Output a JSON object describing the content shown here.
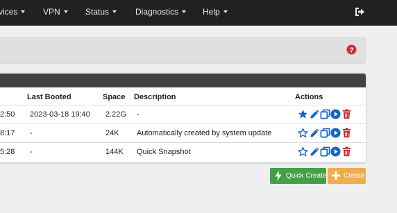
{
  "nav": {
    "items": [
      {
        "label": "vices"
      },
      {
        "label": "VPN"
      },
      {
        "label": "Status"
      },
      {
        "label": "Diagnostics"
      },
      {
        "label": "Help"
      }
    ],
    "logout_icon": "sign-out-icon"
  },
  "header": {
    "help_icon": "question-circle-icon",
    "help_color": "#d32f2f"
  },
  "table": {
    "columns": {
      "last_booted": "Last Booted",
      "space": "Space",
      "description": "Description",
      "actions": "Actions"
    },
    "rows": [
      {
        "created": "2:50",
        "last_booted": "2023-03-18 19:40",
        "space": "2.22G",
        "description": "-",
        "default": true
      },
      {
        "created": "8:17",
        "last_booted": "-",
        "space": "24K",
        "description": "Automatically created by system update",
        "default": false
      },
      {
        "created": "5:28",
        "last_booted": "-",
        "space": "144K",
        "description": "Quick Snapshot",
        "default": false
      }
    ],
    "action_icons": [
      "star-icon",
      "pencil-icon",
      "copy-icon",
      "play-circle-icon",
      "trash-icon"
    ]
  },
  "buttons": {
    "quick_create": "Quick Create",
    "create": "Create"
  },
  "colors": {
    "navbar": "#212121",
    "accent_blue": "#1565c0",
    "danger": "#c62828",
    "success": "#43a047",
    "warning": "#f0ad4e"
  }
}
